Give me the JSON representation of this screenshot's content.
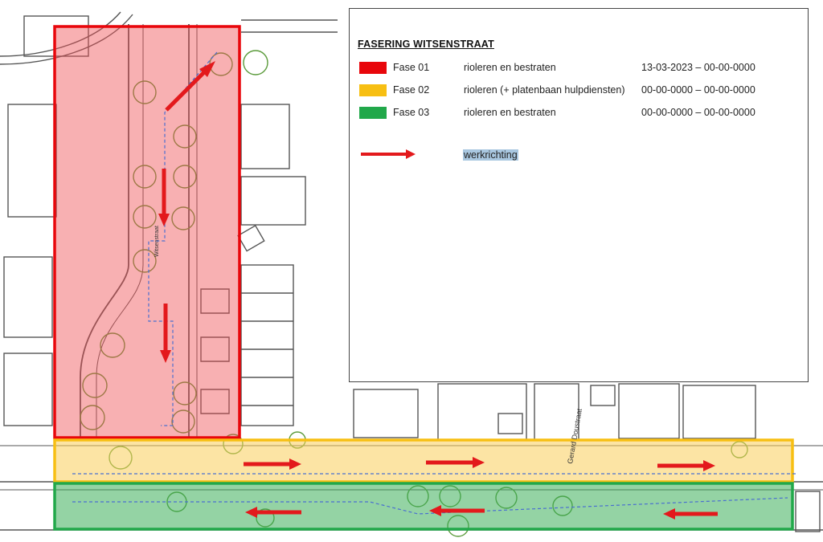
{
  "legend": {
    "title": "FASERING WITSENSTRAAT",
    "phases": [
      {
        "name": "Fase 01",
        "work": "rioleren en bestraten",
        "dates": "13-03-2023 – 00-00-0000",
        "color": "#e8060b"
      },
      {
        "name": "Fase 02",
        "work": "rioleren (+ platenbaan hulpdiensten)",
        "dates": "00-00-0000 – 00-00-0000",
        "color": "#f7bf13"
      },
      {
        "name": "Fase 03",
        "work": "rioleren en bestraten",
        "dates": "00-00-0000 – 00-00-0000",
        "color": "#21a84a"
      }
    ],
    "direction_label": "werkrichting",
    "arrow_color": "#e3191c"
  },
  "map": {
    "street_labels": [
      "Gerard Doustraat",
      "Witsenstraat"
    ],
    "zone_colors": {
      "fase01_fill": "rgba(240,80,85,0.45)",
      "fase02_fill": "rgba(250,205,90,0.55)",
      "fase03_fill": "rgba(60,175,90,0.55)"
    }
  }
}
